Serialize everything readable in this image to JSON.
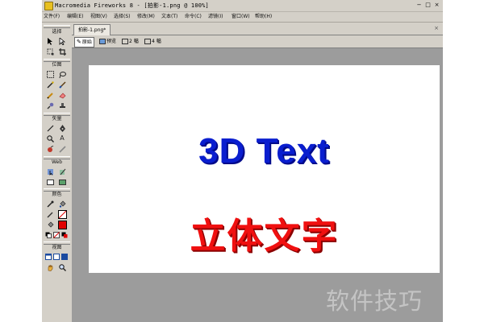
{
  "window": {
    "title": "Macromedia Fireworks 8 - [拍影-1.png @ 100%]",
    "buttons": [
      "−",
      "□",
      "×"
    ]
  },
  "menubar": {
    "items": [
      "文件(F)",
      "编辑(E)",
      "视图(V)",
      "选择(S)",
      "修改(M)",
      "文本(T)",
      "命令(C)",
      "滤镜(I)",
      "窗口(W)",
      "帮助(H)"
    ]
  },
  "tools_panel": {
    "sections": {
      "select": "选择",
      "bitmap": "位图",
      "vector": "矢量",
      "web": "Web",
      "colors": "颜色",
      "view": "视图"
    },
    "tools": {
      "text_tool_glyph": "A"
    },
    "colors": {
      "stroke": "#1a1a1a",
      "fill": "#e00000"
    }
  },
  "document": {
    "tab_label": "拍影-1.png*",
    "view_buttons": [
      "原始",
      "预览",
      "2 幅",
      "4 幅"
    ],
    "active_view": "原始",
    "close_symbol": "×"
  },
  "canvas": {
    "headline": "3D Text",
    "headline_color": "#0a1ecf",
    "subheadline": "立体文字",
    "subheadline_color": "#f01010"
  },
  "watermark": {
    "text": "软件技巧"
  }
}
